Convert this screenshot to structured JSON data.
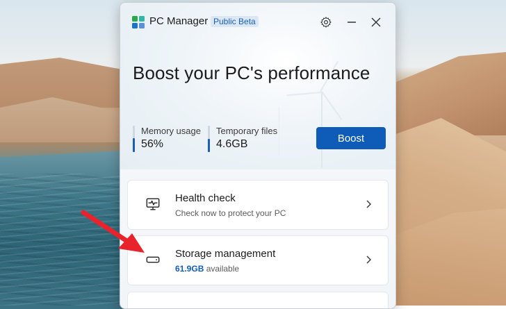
{
  "window": {
    "app_title": "PC Manager",
    "badge": "Public Beta",
    "headline": "Boost your PC's performance"
  },
  "stats": [
    {
      "label": "Memory usage",
      "value": "56%",
      "fill": 0.56
    },
    {
      "label": "Temporary files",
      "value": "4.6GB",
      "fill": 0.55
    }
  ],
  "boost_label": "Boost",
  "cards": {
    "health": {
      "title": "Health check",
      "subtitle": "Check now to protect your PC"
    },
    "storage": {
      "title": "Storage management",
      "available_value": "61.9GB",
      "available_suffix": " available"
    }
  },
  "colors": {
    "accent": "#0f5cb8",
    "annotation_arrow": "#e8232b"
  },
  "icons": {
    "app": "pc-manager-logo",
    "settings": "gear-icon",
    "minimize": "minimize-icon",
    "close": "close-icon",
    "health": "monitor-pulse-icon",
    "storage": "drive-icon",
    "chevron": "chevron-right-icon"
  }
}
